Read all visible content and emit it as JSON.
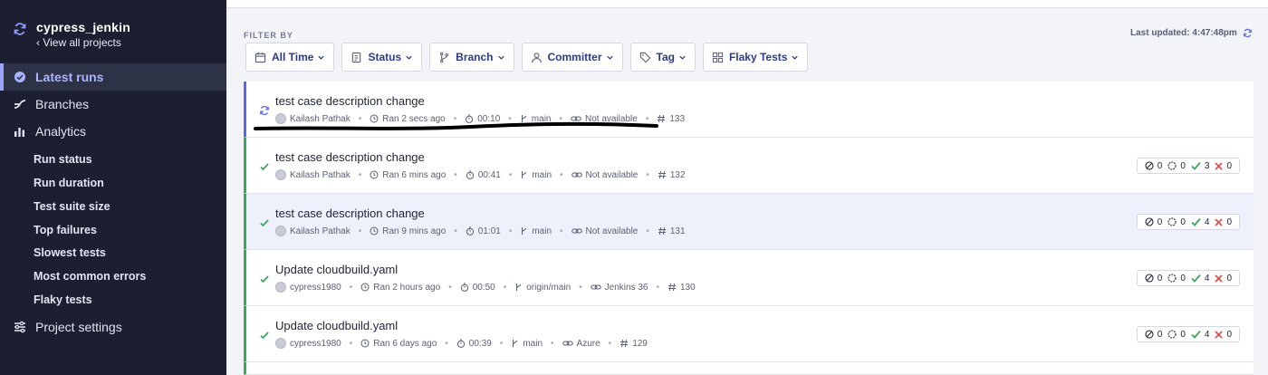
{
  "sidebar": {
    "project_name": "cypress_jenkin",
    "view_all": "View all projects",
    "nav": [
      {
        "label": "Latest runs",
        "icon": "check-circle-icon"
      },
      {
        "label": "Branches",
        "icon": "branch-icon"
      },
      {
        "label": "Analytics",
        "icon": "bar-chart-icon"
      },
      {
        "label": "Project settings",
        "icon": "sliders-icon"
      }
    ],
    "analytics_items": [
      "Run status",
      "Run duration",
      "Test suite size",
      "Top failures",
      "Slowest tests",
      "Most common errors",
      "Flaky tests"
    ]
  },
  "filters": {
    "heading": "FILTER BY",
    "last_updated": "Last updated: 4:47:48pm",
    "buttons": [
      "All Time",
      "Status",
      "Branch",
      "Committer",
      "Tag",
      "Flaky Tests"
    ]
  },
  "runs": [
    {
      "title": "test case description change",
      "author": "Kailash Pathak",
      "ran": "Ran 2 secs ago",
      "duration": "00:10",
      "branch": "main",
      "ci": "Not available",
      "number": "133",
      "status": "running"
    },
    {
      "title": "test case description change",
      "author": "Kailash Pathak",
      "ran": "Ran 6 mins ago",
      "duration": "00:41",
      "branch": "main",
      "ci": "Not available",
      "number": "132",
      "status": "passed",
      "skipped": "0",
      "pending": "0",
      "passed": "3",
      "failed": "0"
    },
    {
      "title": "test case description change",
      "author": "Kailash Pathak",
      "ran": "Ran 9 mins ago",
      "duration": "01:01",
      "branch": "main",
      "ci": "Not available",
      "number": "131",
      "status": "passed",
      "skipped": "0",
      "pending": "0",
      "passed": "4",
      "failed": "0"
    },
    {
      "title": "Update cloudbuild.yaml",
      "author": "cypress1980",
      "ran": "Ran 2 hours ago",
      "duration": "00:50",
      "branch": "origin/main",
      "ci": "Jenkins 36",
      "number": "130",
      "status": "passed",
      "skipped": "0",
      "pending": "0",
      "passed": "4",
      "failed": "0"
    },
    {
      "title": "Update cloudbuild.yaml",
      "author": "cypress1980",
      "ran": "Ran 6 days ago",
      "duration": "00:39",
      "branch": "main",
      "ci": "Azure",
      "number": "129",
      "status": "passed",
      "skipped": "0",
      "pending": "0",
      "passed": "4",
      "failed": "0"
    }
  ],
  "colors": {
    "sidebar_bg": "#1b1f31",
    "accent": "#9aa4ff",
    "passed": "#3ba95b",
    "failed": "#d9534f",
    "running": "#5c66e8"
  }
}
